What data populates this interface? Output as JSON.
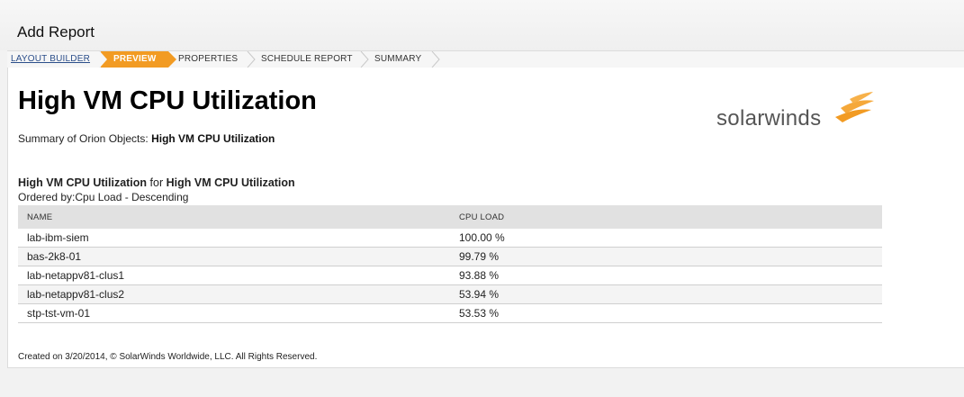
{
  "header": {
    "title": "Add Report"
  },
  "wizard": {
    "steps": [
      {
        "label": "LAYOUT BUILDER",
        "state": "link"
      },
      {
        "label": "PREVIEW",
        "state": "active"
      },
      {
        "label": "PROPERTIES",
        "state": "normal"
      },
      {
        "label": "SCHEDULE REPORT",
        "state": "normal"
      },
      {
        "label": "SUMMARY",
        "state": "normal"
      }
    ],
    "active_color": "#f29b23"
  },
  "report": {
    "title": "High VM CPU Utilization",
    "summary_prefix": "Summary of Orion Objects:",
    "summary_value": "High VM CPU Utilization",
    "logo_text": "solarwinds",
    "logo_color": "#f29b23",
    "section": {
      "name": "High VM CPU Utilization",
      "connector": "for",
      "target": "High VM CPU Utilization",
      "ordered_by": "Ordered by:Cpu Load - Descending"
    },
    "table": {
      "columns": [
        "NAME",
        "CPU LOAD"
      ],
      "rows": [
        [
          "lab-ibm-siem",
          "100.00 %"
        ],
        [
          "bas-2k8-01",
          "99.79 %"
        ],
        [
          "lab-netappv81-clus1",
          "93.88 %"
        ],
        [
          "lab-netappv81-clus2",
          "53.94 %"
        ],
        [
          "stp-tst-vm-01",
          "53.53 %"
        ]
      ]
    },
    "footer": "Created on 3/20/2014,   © SolarWinds Worldwide, LLC. All Rights Reserved."
  }
}
